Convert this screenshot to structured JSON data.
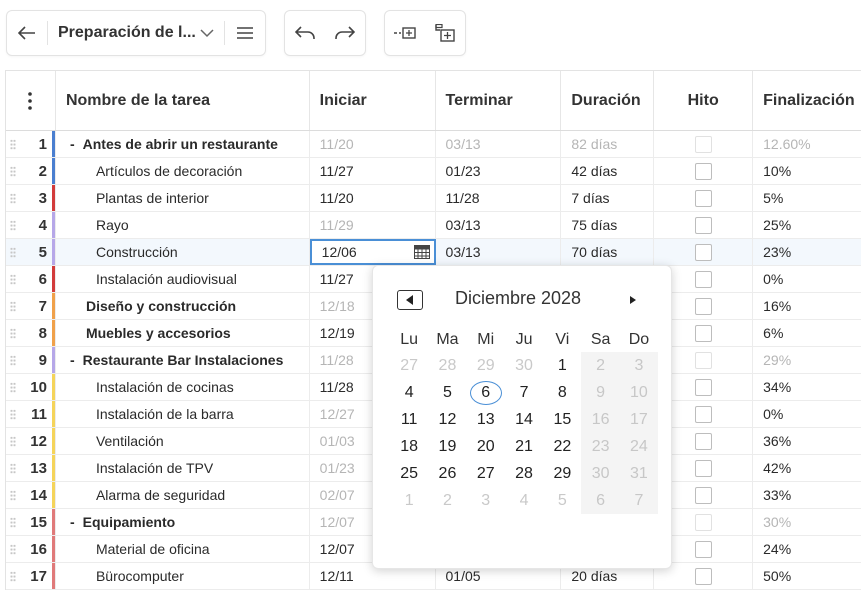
{
  "toolbar": {
    "project_title": "Preparación de l...",
    "icons": [
      "arrow-left-icon",
      "chevron-down-icon",
      "menu-icon",
      "undo-icon",
      "redo-icon",
      "outdent-icon",
      "add-subtask-icon"
    ]
  },
  "columns": {
    "name": "Nombre de la tarea",
    "start": "Iniciar",
    "end": "Terminar",
    "duration": "Duración",
    "milestone": "Hito",
    "completion": "Finalización"
  },
  "rows": [
    {
      "num": "1",
      "name": "Antes de abrir un restaurante",
      "start": "11/20",
      "end": "03/13",
      "duration": "82 días",
      "completion": "12.60%",
      "level": "summary",
      "collapse": "-",
      "muted_dates": true,
      "muted_rest": true,
      "bar": "#4a7fd0"
    },
    {
      "num": "2",
      "name": "Artículos de decoración",
      "start": "11/27",
      "end": "01/23",
      "duration": "42 días",
      "completion": "10%",
      "level": "child",
      "bar": "#4a7fd0"
    },
    {
      "num": "3",
      "name": "Plantas de interior",
      "start": "11/20",
      "end": "11/28",
      "duration": "7 días",
      "completion": "5%",
      "level": "child",
      "bar": "#d23b3b"
    },
    {
      "num": "4",
      "name": "Rayo",
      "start": "11/29",
      "end": "03/13",
      "duration": "75 días",
      "completion": "25%",
      "level": "child",
      "muted_start": true,
      "bar": "#b6a7e8"
    },
    {
      "num": "5",
      "name": "Construcción",
      "start": "12/06",
      "end": "03/13",
      "duration": "70 días",
      "completion": "23%",
      "level": "child",
      "selected": true,
      "editing": true,
      "bar": "#b6a7e8"
    },
    {
      "num": "6",
      "name": "Instalación audiovisual",
      "start": "11/27",
      "end": "",
      "duration": "",
      "completion": "0%",
      "level": "child",
      "bar": "#d23b3b"
    },
    {
      "num": "7",
      "name": "Diseño y construcción",
      "start": "12/18",
      "end": "",
      "duration": "",
      "completion": "16%",
      "level": "summary-nocollapse",
      "muted_start": true,
      "bar": "#f0a14a"
    },
    {
      "num": "8",
      "name": "Muebles y accesorios",
      "start": "12/19",
      "end": "",
      "duration": "",
      "completion": "6%",
      "level": "summary-nocollapse",
      "bar": "#f0a14a"
    },
    {
      "num": "9",
      "name": "Restaurante Bar Instalaciones",
      "start": "11/28",
      "end": "",
      "duration": "",
      "completion": "29%",
      "level": "summary",
      "collapse": "-",
      "muted_start": true,
      "muted_rest": true,
      "bar": "#b6a7e8"
    },
    {
      "num": "10",
      "name": "Instalación de cocinas",
      "start": "11/28",
      "end": "",
      "duration": "",
      "completion": "34%",
      "level": "child",
      "bar": "#f5d45a"
    },
    {
      "num": "11",
      "name": "Instalación de la barra",
      "start": "12/27",
      "end": "",
      "duration": "",
      "completion": "0%",
      "level": "child",
      "muted_start": true,
      "bar": "#f5d45a"
    },
    {
      "num": "12",
      "name": "Ventilación",
      "start": "01/03",
      "end": "",
      "duration": "",
      "completion": "36%",
      "level": "child",
      "muted_start": true,
      "bar": "#f5d45a"
    },
    {
      "num": "13",
      "name": "Instalación de TPV",
      "start": "01/23",
      "end": "",
      "duration": "",
      "completion": "42%",
      "level": "child",
      "muted_start": true,
      "bar": "#f5d45a"
    },
    {
      "num": "14",
      "name": "Alarma de seguridad",
      "start": "02/07",
      "end": "",
      "duration": "",
      "completion": "33%",
      "level": "child",
      "muted_start": true,
      "bar": "#f5d45a"
    },
    {
      "num": "15",
      "name": "Equipamiento",
      "start": "12/07",
      "end": "",
      "duration": "",
      "completion": "30%",
      "level": "summary",
      "collapse": "-",
      "muted_start": true,
      "muted_rest": true,
      "bar": "#e07a7a"
    },
    {
      "num": "16",
      "name": "Material de oficina",
      "start": "12/07",
      "end": "",
      "duration": "",
      "completion": "24%",
      "level": "child",
      "bar": "#e07a7a"
    },
    {
      "num": "17",
      "name": "Bürocomputer",
      "start": "12/11",
      "end": "01/05",
      "duration": "20 días",
      "completion": "50%",
      "level": "child",
      "bar": "#e07a7a"
    }
  ],
  "date_picker": {
    "month_title": "Diciembre 2028",
    "weekdays": [
      "Lu",
      "Ma",
      "Mi",
      "Ju",
      "Vi",
      "Sa",
      "Do"
    ],
    "weeks": [
      [
        {
          "d": "27",
          "out": true
        },
        {
          "d": "28",
          "out": true
        },
        {
          "d": "29",
          "out": true
        },
        {
          "d": "30",
          "out": true
        },
        {
          "d": "1"
        },
        {
          "d": "2",
          "wknd": true
        },
        {
          "d": "3",
          "wknd": true
        }
      ],
      [
        {
          "d": "4"
        },
        {
          "d": "5"
        },
        {
          "d": "6",
          "sel": true
        },
        {
          "d": "7"
        },
        {
          "d": "8"
        },
        {
          "d": "9",
          "wknd": true
        },
        {
          "d": "10",
          "wknd": true
        }
      ],
      [
        {
          "d": "11"
        },
        {
          "d": "12"
        },
        {
          "d": "13"
        },
        {
          "d": "14"
        },
        {
          "d": "15"
        },
        {
          "d": "16",
          "wknd": true
        },
        {
          "d": "17",
          "wknd": true
        }
      ],
      [
        {
          "d": "18"
        },
        {
          "d": "19"
        },
        {
          "d": "20"
        },
        {
          "d": "21"
        },
        {
          "d": "22"
        },
        {
          "d": "23",
          "wknd": true
        },
        {
          "d": "24",
          "wknd": true
        }
      ],
      [
        {
          "d": "25"
        },
        {
          "d": "26"
        },
        {
          "d": "27"
        },
        {
          "d": "28"
        },
        {
          "d": "29"
        },
        {
          "d": "30",
          "wknd": true
        },
        {
          "d": "31",
          "wknd": true
        }
      ],
      [
        {
          "d": "1",
          "out": true
        },
        {
          "d": "2",
          "out": true
        },
        {
          "d": "3",
          "out": true
        },
        {
          "d": "4",
          "out": true
        },
        {
          "d": "5",
          "out": true
        },
        {
          "d": "6",
          "out": true,
          "wknd": true
        },
        {
          "d": "7",
          "out": true,
          "wknd": true
        }
      ]
    ]
  }
}
